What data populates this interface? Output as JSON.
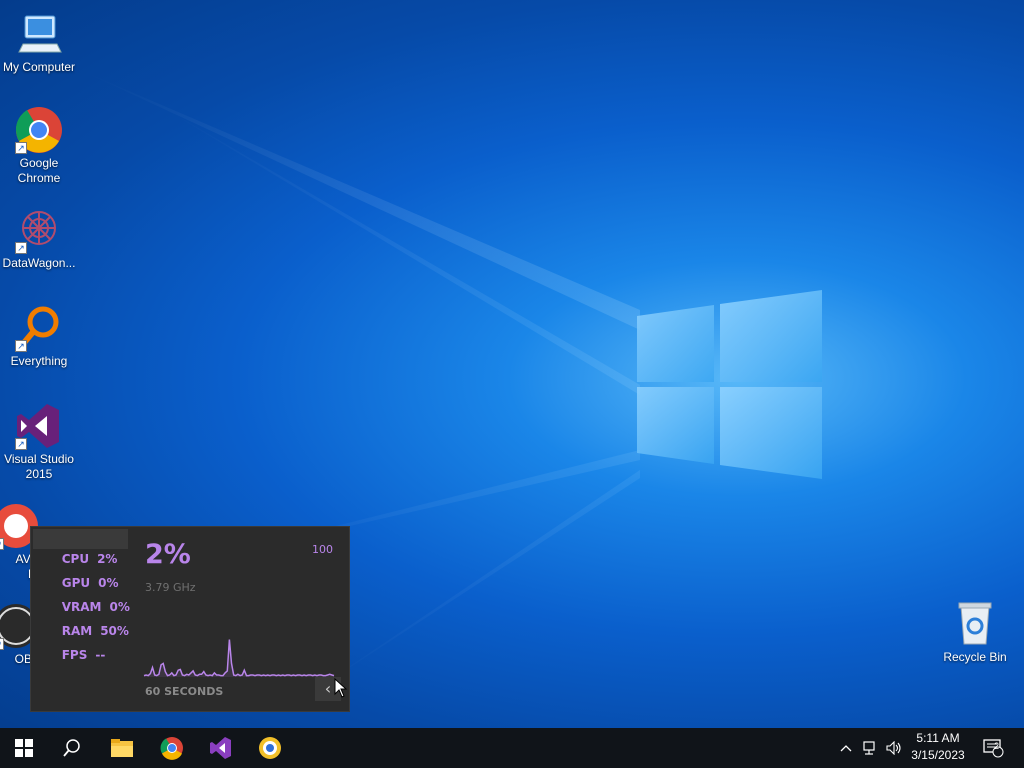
{
  "desktop": {
    "icons": [
      {
        "label": "My Computer"
      },
      {
        "label": "Google Chrome"
      },
      {
        "label": "DataWagon..."
      },
      {
        "label": "Everything"
      },
      {
        "label": "Visual Studio 2015"
      },
      {
        "label": "AVG Secure Browser",
        "visible_fragment_1": "AVG",
        "visible_fragment_2": "Br"
      },
      {
        "label": "OBS",
        "visible_fragment_1": "OBS"
      }
    ],
    "recycle_bin": {
      "label": "Recycle Bin"
    }
  },
  "perf_overlay": {
    "metrics": [
      {
        "name": "CPU",
        "value": "2%"
      },
      {
        "name": "GPU",
        "value": "0%"
      },
      {
        "name": "VRAM",
        "value": "0%"
      },
      {
        "name": "RAM",
        "value": "50%"
      },
      {
        "name": "FPS",
        "value": "--"
      }
    ],
    "selected_metric": "CPU",
    "big_value": "2%",
    "max_label": "100",
    "frequency": "3.79 GHz",
    "span_label": "60 SECONDS",
    "collapse_icon": "chevron-left-icon",
    "accent_color": "#b985ea",
    "history": [
      2,
      3,
      2,
      5,
      14,
      3,
      2,
      4,
      18,
      20,
      8,
      2,
      3,
      6,
      2,
      3,
      10,
      11,
      3,
      2,
      4,
      3,
      6,
      9,
      3,
      2,
      4,
      4,
      8,
      3,
      2,
      3,
      2,
      6,
      3,
      3,
      2,
      2,
      6,
      9,
      55,
      20,
      3,
      2,
      4,
      2,
      3,
      10,
      2,
      2,
      3,
      3,
      2,
      3,
      3,
      2,
      3,
      2,
      3,
      2,
      3,
      3,
      2,
      3,
      2,
      3,
      2,
      3,
      3,
      2,
      3,
      2,
      3,
      3,
      2,
      3,
      2,
      3,
      3,
      2,
      3,
      2,
      3,
      3,
      2,
      2,
      3,
      4,
      3,
      2
    ]
  },
  "taskbar": {
    "start_icon": "windows-logo-icon",
    "search_icon": "search-icon",
    "pinned": [
      "file-explorer-icon",
      "chrome-icon",
      "visual-studio-icon",
      "avg-browser-icon"
    ],
    "tray_icons": [
      "chevron-up-icon",
      "network-icon",
      "volume-icon"
    ],
    "time": "5:11 AM",
    "date": "3/15/2023",
    "notification_count": "2"
  }
}
